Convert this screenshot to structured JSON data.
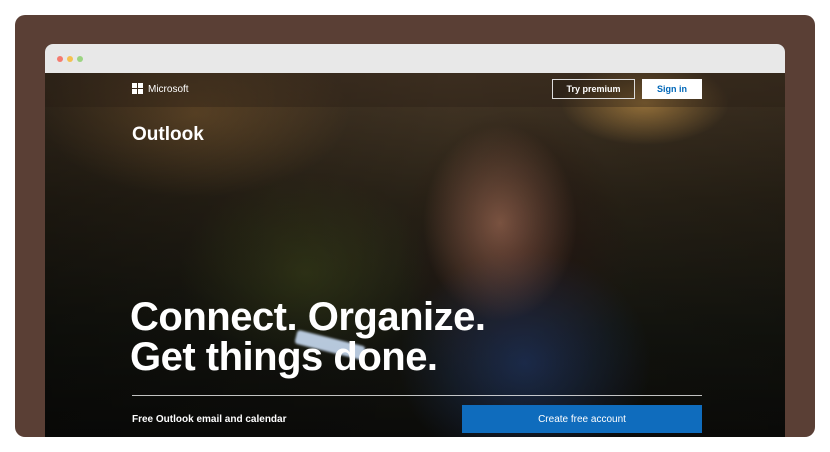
{
  "window": {
    "controls": [
      "close",
      "minimize",
      "maximize"
    ]
  },
  "header": {
    "brand": "Microsoft",
    "logo_icon": "microsoft-logo-icon",
    "try_premium_label": "Try premium",
    "sign_in_label": "Sign in"
  },
  "hero": {
    "product_name": "Outlook",
    "headline_line1": "Connect. Organize.",
    "headline_line2": "Get things done.",
    "subtitle": "Free Outlook email and calendar",
    "cta_label": "Create free account"
  },
  "colors": {
    "frame_bg": "#5a3f35",
    "cta_blue": "#0f6cbd",
    "sign_in_text": "#0067b8"
  }
}
